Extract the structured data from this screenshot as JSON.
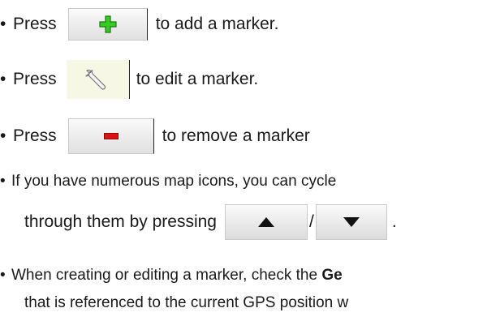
{
  "lines": {
    "add": {
      "bullet": "•",
      "press": "Press",
      "after": "to add a marker."
    },
    "edit": {
      "bullet": "•",
      "press": "Press",
      "after": "to edit a marker."
    },
    "remove": {
      "bullet": "•",
      "press": "Press",
      "after": "to remove a marker"
    },
    "cycle": {
      "bullet": "•",
      "text": "If you have numerous map icons, you can cycle"
    },
    "cycle2": {
      "text": "through them by pressing",
      "slash": "/",
      "end": "."
    },
    "geo": {
      "bullet": "•",
      "text": "When creating or editing a marker, check the ",
      "bold": "Ge"
    },
    "geo2": {
      "text": "that is referenced to the current GPS position w"
    }
  },
  "icons": {
    "add": "plus-icon",
    "edit": "wrench-icon",
    "remove": "minus-icon",
    "up": "triangle-up-icon",
    "down": "triangle-down-icon"
  },
  "colors": {
    "plus_fill": "#33cc22",
    "minus_fill": "#dd1111",
    "triangle": "#111111"
  }
}
